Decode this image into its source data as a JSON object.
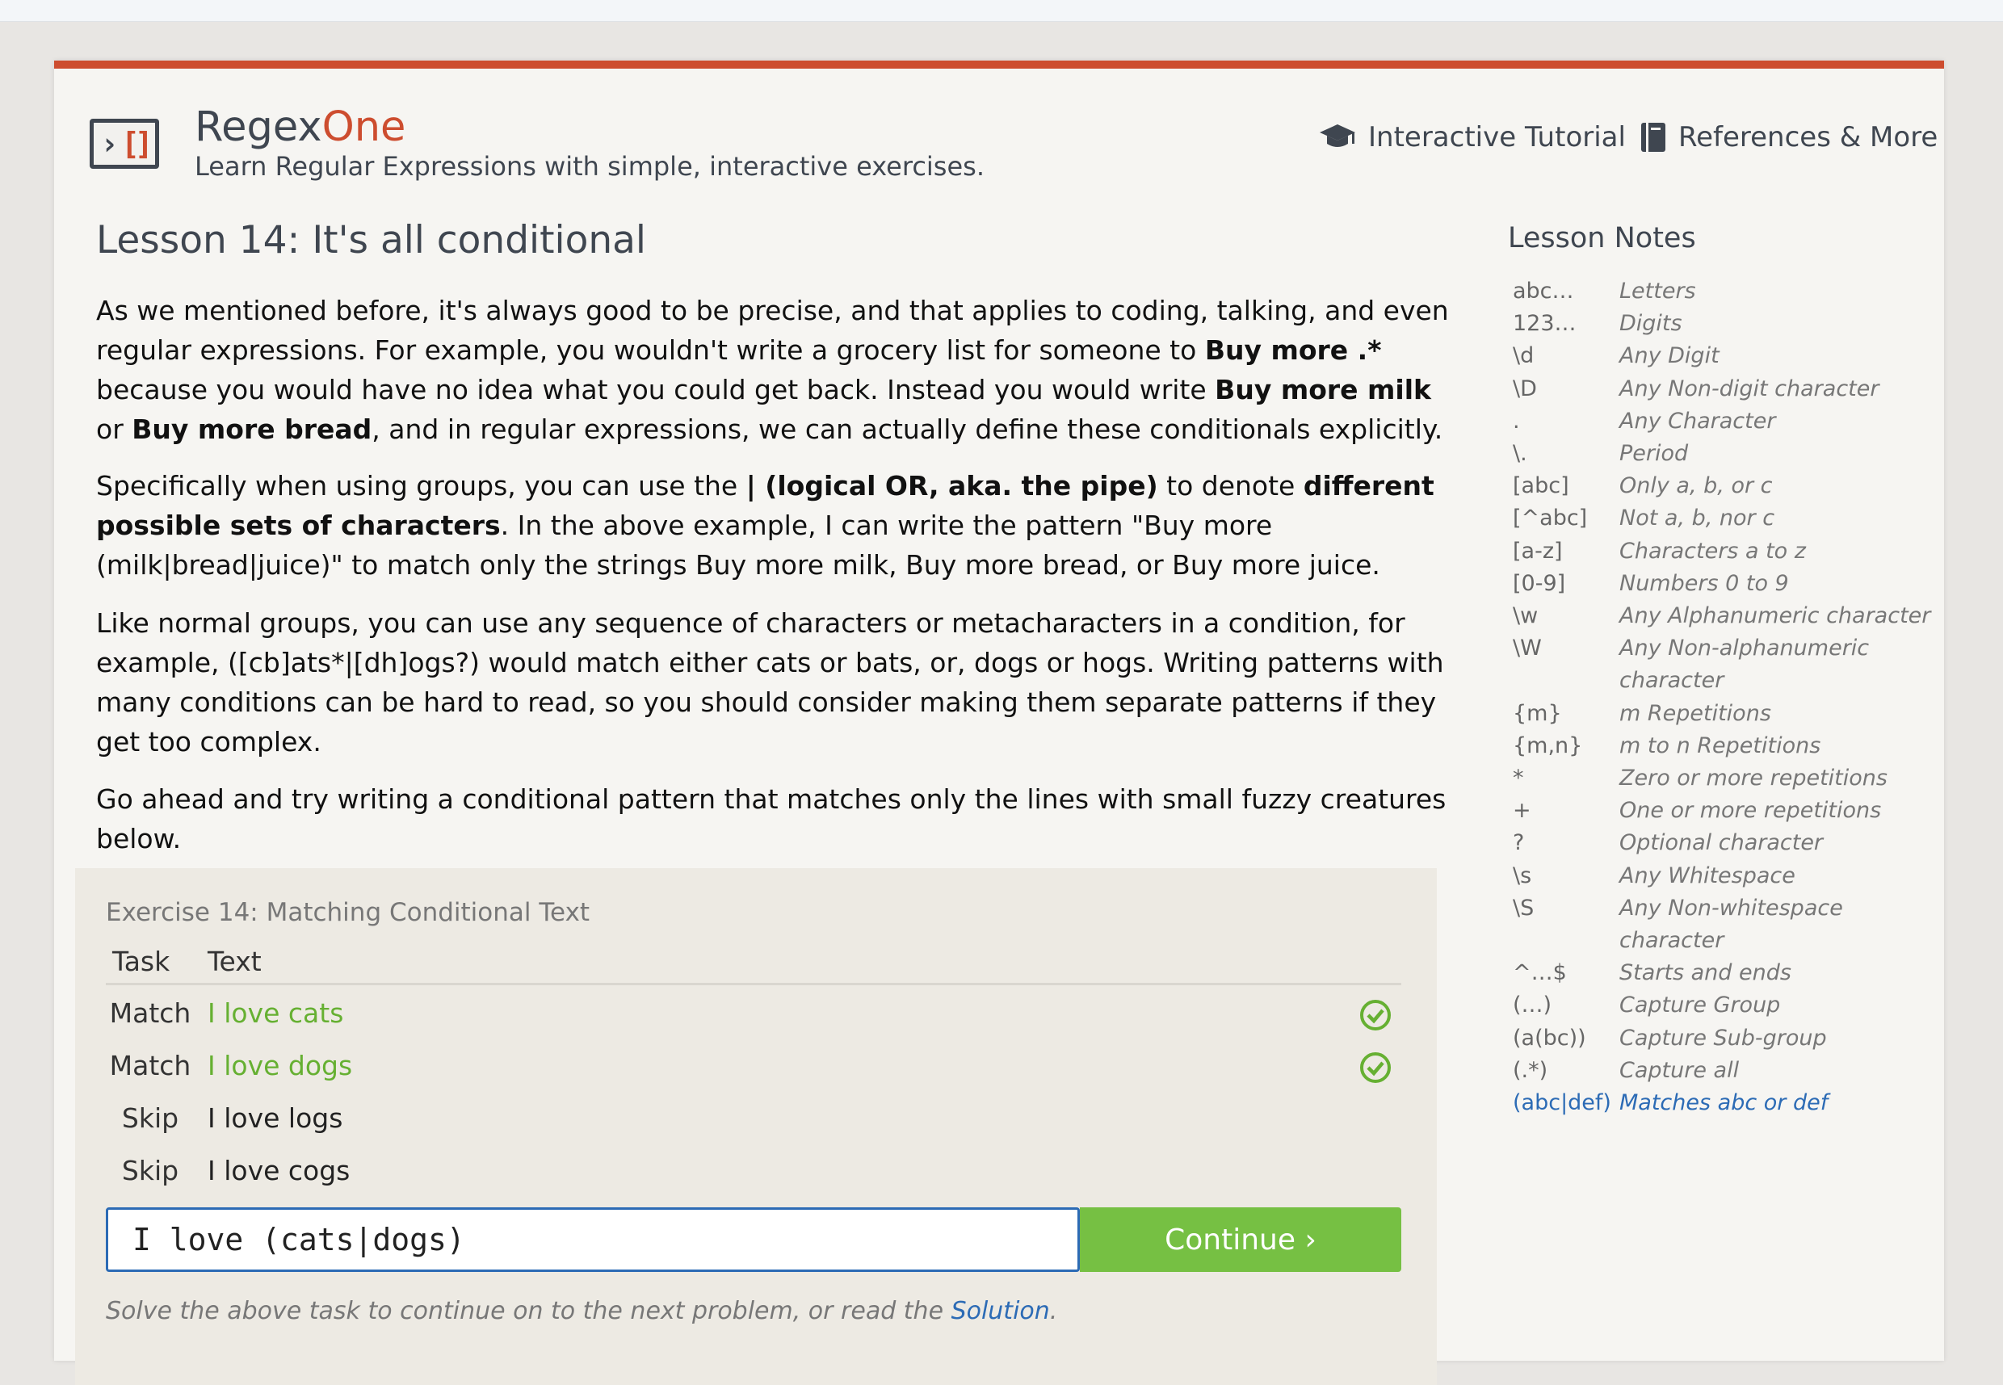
{
  "header": {
    "brand_regex": "Regex",
    "brand_one": "One",
    "tagline": "Learn Regular Expressions with simple, interactive exercises.",
    "nav": {
      "tutorial": "Interactive Tutorial",
      "references": "References & More"
    }
  },
  "lesson": {
    "title": "Lesson 14: It's all conditional",
    "p1": [
      "As we mentioned before, it's always good to be precise, and that applies to coding, talking, and even regular expressions. For example, you wouldn't write a grocery list for someone to ",
      "Buy more .*",
      " because you would have no idea what you could get back. Instead you would write ",
      "Buy more milk",
      " or ",
      "Buy more bread",
      ", and in regular expressions, we can actually define these conditionals explicitly."
    ],
    "p2": [
      "Specifically when using groups, you can use the ",
      "| (logical OR, aka. the pipe)",
      " to denote ",
      "different possible sets of characters",
      ". In the above example, I can write the pattern \"Buy more (milk|bread|juice)\" to match only the strings Buy more milk, Buy more bread, or Buy more juice."
    ],
    "p3": "Like normal groups, you can use any sequence of characters or metacharacters in a condition, for example, ([cb]ats*|[dh]ogs?) would match either cats or bats, or, dogs or hogs. Writing patterns with many conditions can be hard to read, so you should consider making them separate patterns if they get too complex.",
    "p4": "Go ahead and try writing a conditional pattern that matches only the lines with small fuzzy creatures below."
  },
  "exercise": {
    "title": "Exercise 14: Matching Conditional Text",
    "col_task": "Task",
    "col_text": "Text",
    "rows": [
      {
        "task": "Match",
        "text": "I love cats",
        "status": "matched"
      },
      {
        "task": "Match",
        "text": "I love dogs",
        "status": "matched"
      },
      {
        "task": "Skip",
        "text": "I love logs",
        "status": ""
      },
      {
        "task": "Skip",
        "text": "I love cogs",
        "status": ""
      }
    ],
    "input_value": "I love (cats|dogs)",
    "continue_label": "Continue ›",
    "hint_prefix": "Solve the above task to continue on to the next problem, or read the ",
    "hint_link": "Solution",
    "hint_suffix": "."
  },
  "notes": {
    "title": "Lesson Notes",
    "items": [
      {
        "k": "abc…",
        "v": "Letters"
      },
      {
        "k": "123…",
        "v": "Digits"
      },
      {
        "k": "\\d",
        "v": "Any Digit"
      },
      {
        "k": "\\D",
        "v": "Any Non-digit character"
      },
      {
        "k": ".",
        "v": "Any Character"
      },
      {
        "k": "\\.",
        "v": "Period"
      },
      {
        "k": "[abc]",
        "v": "Only a, b, or c"
      },
      {
        "k": "[^abc]",
        "v": "Not a, b, nor c"
      },
      {
        "k": "[a-z]",
        "v": "Characters a to z"
      },
      {
        "k": "[0-9]",
        "v": "Numbers 0 to 9"
      },
      {
        "k": "\\w",
        "v": "Any Alphanumeric character"
      },
      {
        "k": "\\W",
        "v": "Any Non-alphanumeric"
      },
      {
        "k": "",
        "v": "character"
      },
      {
        "k": "{m}",
        "v": "m Repetitions"
      },
      {
        "k": "{m,n}",
        "v": "m to n Repetitions"
      },
      {
        "k": "*",
        "v": "Zero or more repetitions"
      },
      {
        "k": "+",
        "v": "One or more repetitions"
      },
      {
        "k": "?",
        "v": "Optional character"
      },
      {
        "k": "\\s",
        "v": "Any Whitespace"
      },
      {
        "k": "\\S",
        "v": "Any Non-whitespace character"
      },
      {
        "k": "^…$",
        "v": "Starts and ends"
      },
      {
        "k": "(…)",
        "v": "Capture Group"
      },
      {
        "k": "(a(bc))",
        "v": "Capture Sub-group"
      },
      {
        "k": "(.*)",
        "v": "Capture all"
      },
      {
        "k": "(abc|def)",
        "v": "Matches abc or def",
        "highlight": true
      }
    ]
  },
  "colors": {
    "accent": "#cd4d2f",
    "match_green": "#66b032",
    "button_green": "#76c043",
    "link_blue": "#2c6bb5"
  }
}
